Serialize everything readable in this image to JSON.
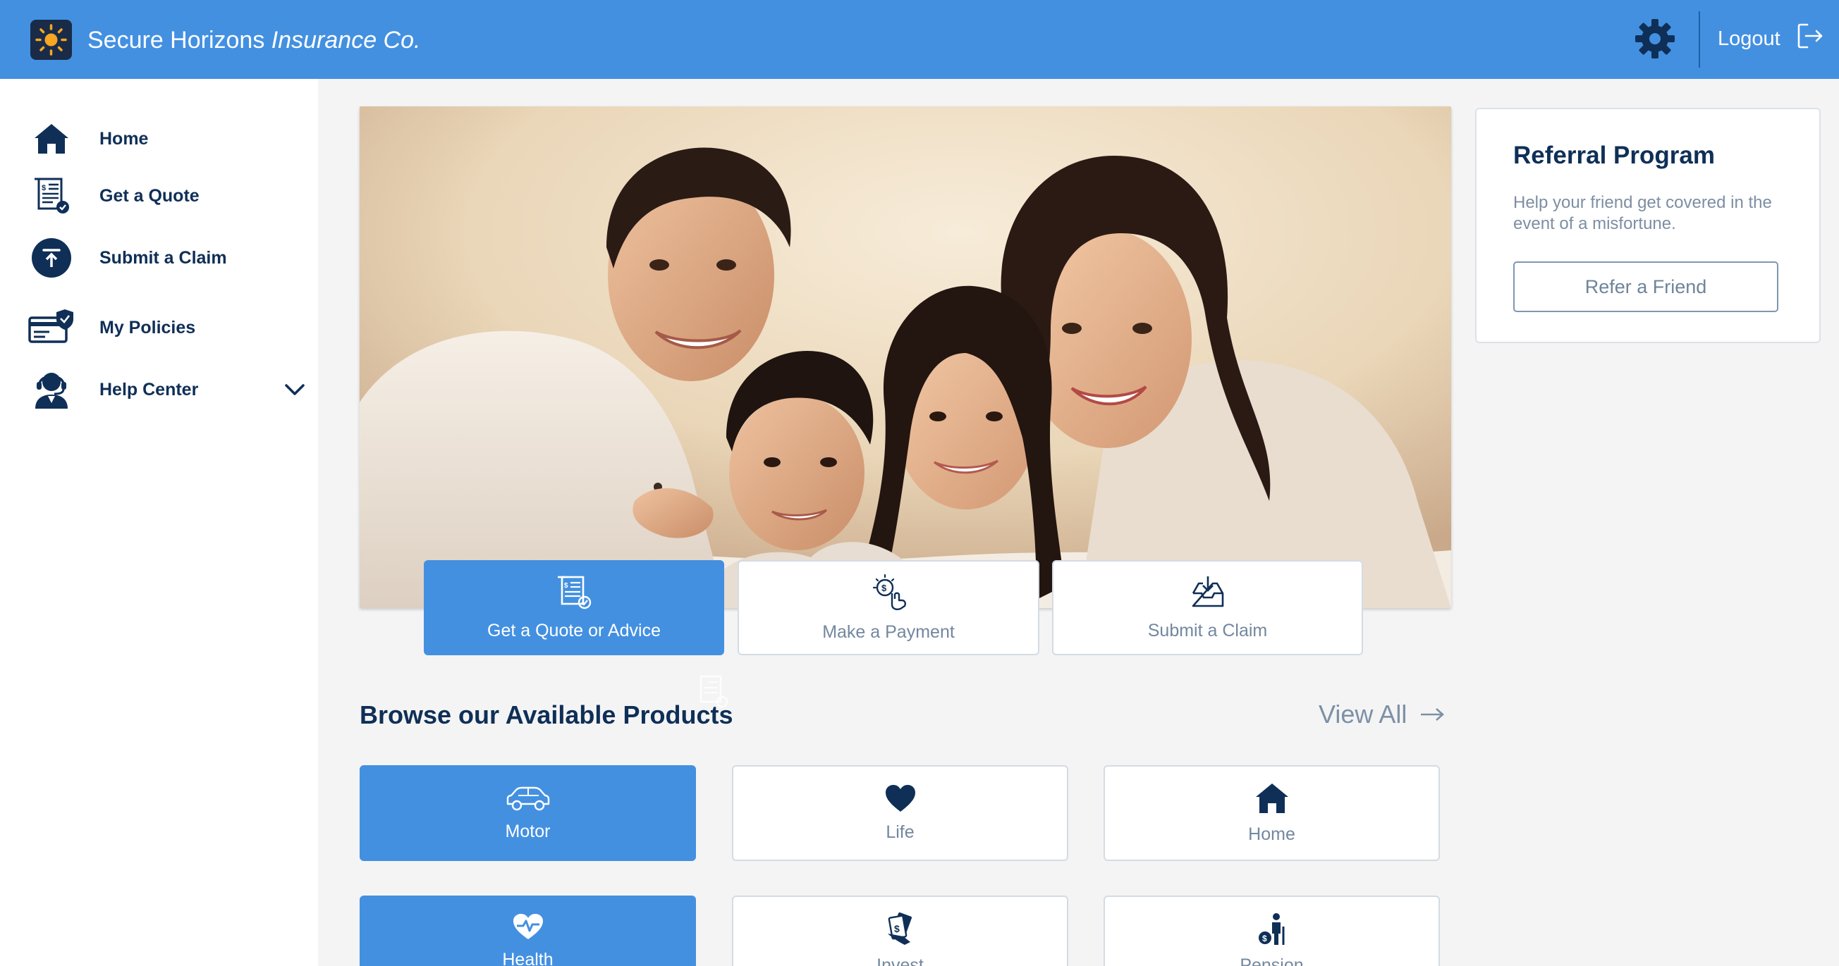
{
  "header": {
    "brand_name": "Secure Horizons",
    "brand_suffix": "Insurance Co.",
    "logout_label": "Logout",
    "logo_icon": "sun-icon",
    "settings_icon": "gear-icon",
    "logout_icon": "logout-icon"
  },
  "sidebar": {
    "items": [
      {
        "label": "Home",
        "icon": "home-icon"
      },
      {
        "label": "Get a Quote",
        "icon": "quote-receipt-icon"
      },
      {
        "label": "Submit a Claim",
        "icon": "upload-claim-icon"
      },
      {
        "label": "My Policies",
        "icon": "policy-card-shield-icon"
      },
      {
        "label": "Help Center",
        "icon": "support-agent-icon"
      }
    ],
    "help_center_chevron": "chevron-down-icon"
  },
  "actions": [
    {
      "label": "Get a Quote or Advice",
      "icon": "quote-receipt-icon",
      "active": true
    },
    {
      "label": "Make a Payment",
      "icon": "coin-hand-icon",
      "active": false
    },
    {
      "label": "Submit a Claim",
      "icon": "inbox-download-icon",
      "active": false
    }
  ],
  "referral": {
    "title": "Referral Program",
    "description": "Help your friend get covered in the event of a misfortune.",
    "button_label": "Refer a Friend"
  },
  "products": {
    "title": "Browse our Available Products",
    "view_all_label": "View All",
    "items": [
      {
        "label": "Motor",
        "icon": "car-icon",
        "active": true
      },
      {
        "label": "Life",
        "icon": "heart-icon",
        "active": false
      },
      {
        "label": "Home",
        "icon": "home-icon",
        "active": false
      },
      {
        "label": "Health",
        "icon": "heartbeat-icon",
        "active": true
      },
      {
        "label": "Invest",
        "icon": "money-hand-icon",
        "active": false
      },
      {
        "label": "Pension",
        "icon": "elder-cane-icon",
        "active": false
      }
    ]
  },
  "colors": {
    "brand_blue": "#4390e1",
    "navy": "#0f2f57",
    "muted_text": "#73879e",
    "page_bg": "#f4f4f4"
  }
}
